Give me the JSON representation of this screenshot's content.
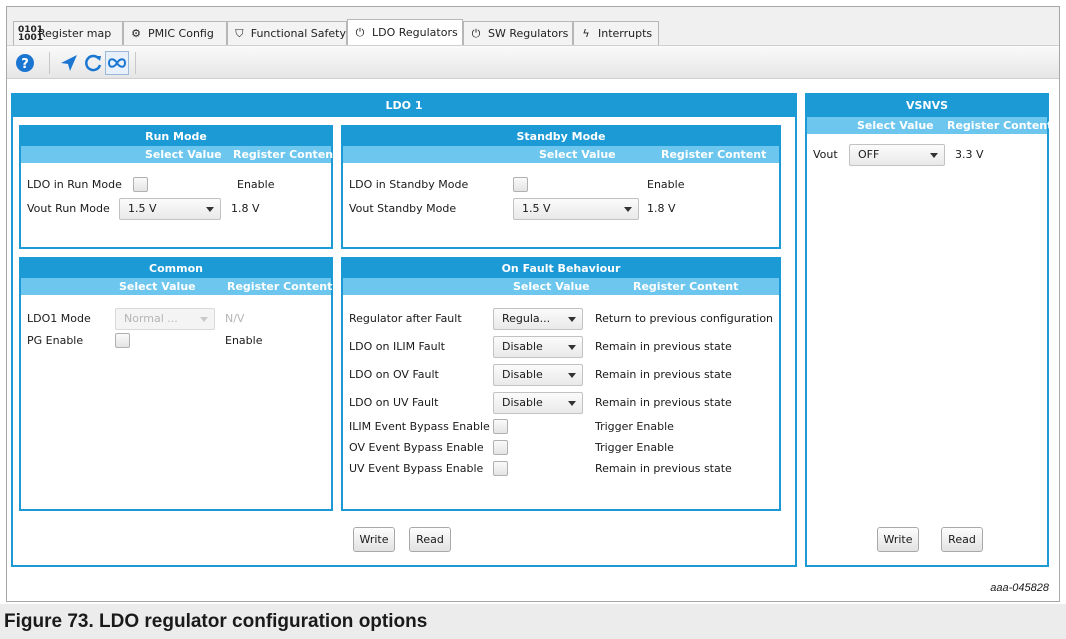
{
  "tabs": [
    {
      "label": "Register map",
      "icon": "register-map-icon",
      "glyph": "▦",
      "active": false
    },
    {
      "label": "PMIC Config",
      "icon": "gear-icon",
      "glyph": "⚙",
      "active": false
    },
    {
      "label": "Functional Safety",
      "icon": "shield-icon",
      "glyph": "⛉",
      "active": false
    },
    {
      "label": "LDO Regulators",
      "icon": "power-icon",
      "glyph": "⏻",
      "active": true
    },
    {
      "label": "SW Regulators",
      "icon": "power-icon",
      "glyph": "⏻",
      "active": false
    },
    {
      "label": "Interrupts",
      "icon": "lightning-icon",
      "glyph": "ϟ",
      "active": false
    }
  ],
  "toolbar": {
    "help_icon": "help-icon",
    "send_icon": "send-icon",
    "refresh_icon": "refresh-icon",
    "loop_icon": "infinity-icon"
  },
  "ldo1": {
    "title": "LDO 1",
    "run_mode": {
      "title": "Run Mode",
      "col_select": "Select Value",
      "col_register": "Register Content",
      "rows": [
        {
          "label": "LDO in Run Mode",
          "type": "checkbox",
          "checked": false,
          "register": "Enable"
        },
        {
          "label": "Vout Run Mode",
          "type": "select",
          "value": "1.5 V",
          "register": "1.8 V"
        }
      ]
    },
    "standby_mode": {
      "title": "Standby Mode",
      "col_select": "Select Value",
      "col_register": "Register Content",
      "rows": [
        {
          "label": "LDO in Standby Mode",
          "type": "checkbox",
          "checked": false,
          "register": "Enable"
        },
        {
          "label": "Vout Standby Mode",
          "type": "select",
          "value": "1.5 V",
          "register": "1.8 V"
        }
      ]
    },
    "common": {
      "title": "Common",
      "col_select": "Select Value",
      "col_register": "Register Content",
      "rows": [
        {
          "label": "LDO1 Mode",
          "type": "select",
          "value": "Normal ...",
          "disabled": true,
          "register": "N/V"
        },
        {
          "label": "PG Enable",
          "type": "checkbox",
          "checked": false,
          "register": "Enable"
        }
      ]
    },
    "fault": {
      "title": "On Fault Behaviour",
      "col_select": "Select Value",
      "col_register": "Register Content",
      "rows": [
        {
          "label": "Regulator after Fault",
          "type": "select",
          "value": "Regula...",
          "register": "Return to previous configuration"
        },
        {
          "label": "LDO on ILIM Fault",
          "type": "select",
          "value": "Disable",
          "register": "Remain in previous state"
        },
        {
          "label": "LDO on OV Fault",
          "type": "select",
          "value": "Disable",
          "register": "Remain in previous state"
        },
        {
          "label": "LDO on UV Fault",
          "type": "select",
          "value": "Disable",
          "register": "Remain in previous state"
        },
        {
          "label": "ILIM Event Bypass Enable",
          "type": "checkbox",
          "checked": false,
          "register": "Trigger Enable"
        },
        {
          "label": "OV Event Bypass Enable",
          "type": "checkbox",
          "checked": false,
          "register": "Trigger Enable"
        },
        {
          "label": "UV Event Bypass Enable",
          "type": "checkbox",
          "checked": false,
          "register": "Remain in previous state"
        }
      ]
    },
    "write_label": "Write",
    "read_label": "Read"
  },
  "vsnvs": {
    "title": "VSNVS",
    "col_select": "Select Value",
    "col_register": "Register Content",
    "vout_label": "Vout",
    "vout_value": "OFF",
    "vout_register": "3.3 V",
    "write_label": "Write",
    "read_label": "Read"
  },
  "figure_id": "aaa-045828",
  "caption": "Figure 73.  LDO regulator configuration options"
}
